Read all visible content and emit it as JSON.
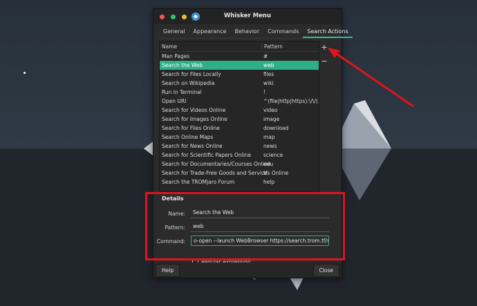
{
  "window": {
    "title": "Whisker Menu",
    "app_icon": "whisker-mouse-icon"
  },
  "tabs": [
    {
      "label": "General"
    },
    {
      "label": "Appearance"
    },
    {
      "label": "Behavior"
    },
    {
      "label": "Commands"
    },
    {
      "label": "Search Actions",
      "active": true
    }
  ],
  "table": {
    "headers": {
      "name": "Name",
      "pattern": "Pattern"
    },
    "rows": [
      {
        "name": "Man Pages",
        "pattern": "#"
      },
      {
        "name": "Search the Web",
        "pattern": "web",
        "selected": true
      },
      {
        "name": "Search for Files Locally",
        "pattern": "files"
      },
      {
        "name": "Search on Wikipedia",
        "pattern": "wiki"
      },
      {
        "name": "Run in Terminal",
        "pattern": "!"
      },
      {
        "name": "Open URI",
        "pattern": "^(file|http|https):\\/\\/(.*)$"
      },
      {
        "name": "Search for Videos Online",
        "pattern": "video"
      },
      {
        "name": "Search for Images Online",
        "pattern": "image"
      },
      {
        "name": "Search for Files Online",
        "pattern": "download"
      },
      {
        "name": "Search Online Maps",
        "pattern": "map"
      },
      {
        "name": "Search for News Online",
        "pattern": "news"
      },
      {
        "name": "Search for Scientific Papers Online",
        "pattern": "science"
      },
      {
        "name": "Search for Documentaries/Courses Online",
        "pattern": "edu"
      },
      {
        "name": "Search for Trade-Free Goods and Services Online",
        "pattern": "tf"
      },
      {
        "name": "Search the TROMjaro Forum",
        "pattern": "help"
      }
    ]
  },
  "side_buttons": {
    "add": "+",
    "remove": "−"
  },
  "details": {
    "heading": "Details",
    "name_label": "Name:",
    "name_value": "Search the Web",
    "pattern_label": "Pattern:",
    "pattern_value": "web",
    "command_label": "Command:",
    "command_value": "o-open --launch WebBrowser https://search.trom.tf/search?q=%s",
    "regex_label": "Regular expression",
    "regex_checked": false
  },
  "footer": {
    "help": "Help",
    "close": "Close"
  },
  "colors": {
    "accent": "#2db089",
    "annotation": "#e0141a"
  }
}
